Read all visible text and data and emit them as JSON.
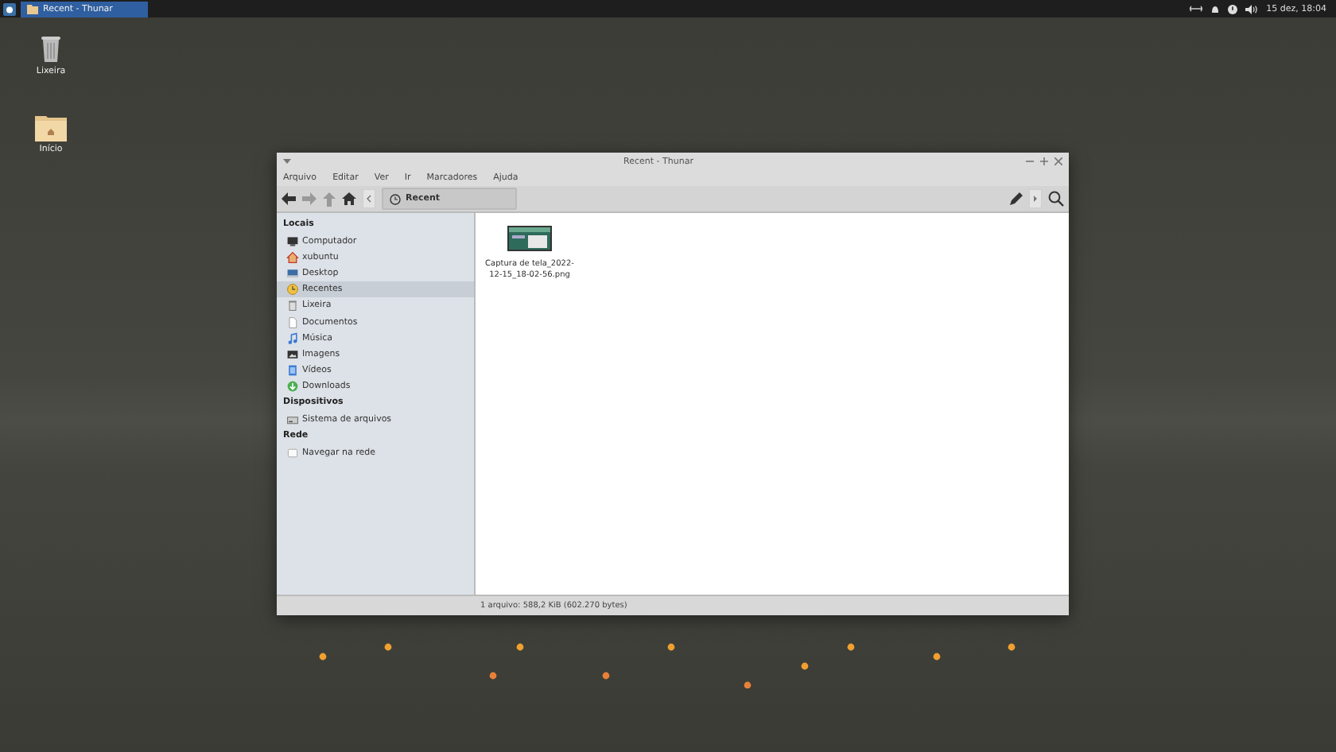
{
  "panel": {
    "task": {
      "title": "Recent - Thunar",
      "selected": true
    },
    "clock": "15 dez, 18:04"
  },
  "desktop_icons": [
    {
      "label": "Lixeira"
    },
    {
      "label": "Início"
    }
  ],
  "window": {
    "title": "Recent - Thunar",
    "menu": [
      "Arquivo",
      "Editar",
      "Ver",
      "Ir",
      "Marcadores",
      "Ajuda"
    ],
    "location": "Recent",
    "sidebar": [
      {
        "heading": "Locais",
        "items": [
          {
            "label": "Computador",
            "selected": false
          },
          {
            "label": "xubuntu",
            "selected": false
          },
          {
            "label": "Desktop",
            "selected": false
          },
          {
            "label": "Recentes",
            "selected": true
          },
          {
            "label": "Lixeira",
            "selected": false
          },
          {
            "label": "Documentos",
            "selected": false
          },
          {
            "label": "Música",
            "selected": false
          },
          {
            "label": "Imagens",
            "selected": false
          },
          {
            "label": "Vídeos",
            "selected": false
          },
          {
            "label": "Downloads",
            "selected": false
          }
        ]
      },
      {
        "heading": "Dispositivos",
        "items": [
          {
            "label": "Sistema de arquivos",
            "selected": false
          }
        ]
      },
      {
        "heading": "Rede",
        "items": [
          {
            "label": "Navegar na rede",
            "selected": false
          }
        ]
      }
    ],
    "files": [
      {
        "name": "Captura de tela_2022-12-15_18-02-56.png"
      }
    ],
    "status": "1 arquivo: 588,2 KiB (602.270 bytes)"
  }
}
